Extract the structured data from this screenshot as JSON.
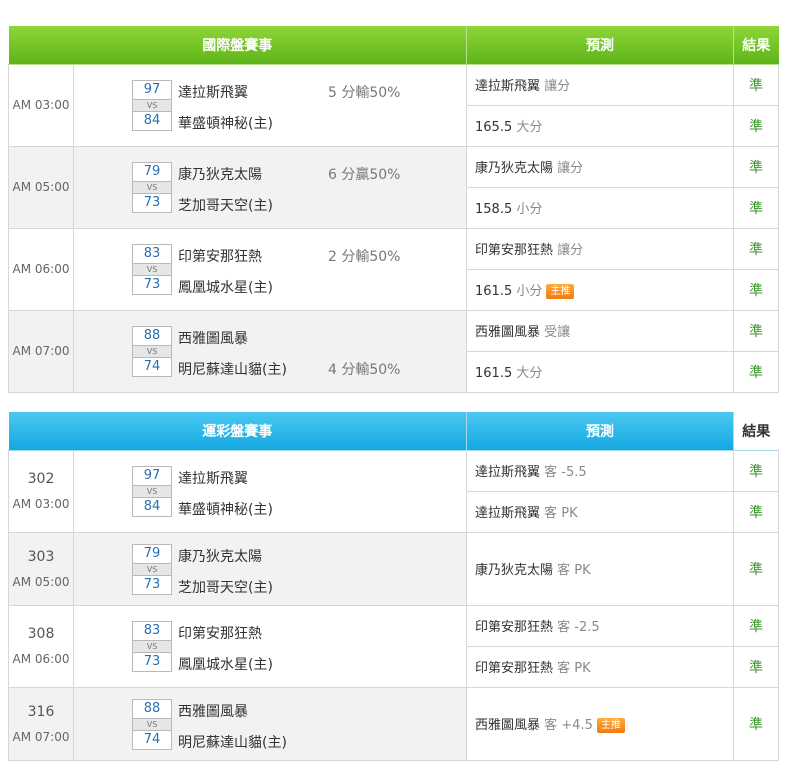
{
  "intl": {
    "header": {
      "match": "國際盤賽事",
      "pred": "預測",
      "res": "結果"
    },
    "games": [
      {
        "time": "AM 03:00",
        "s1": "97",
        "s2": "84",
        "t1": "達拉斯飛翼",
        "t2": "華盛頓神秘(主)",
        "hcp": "5 分輸50%",
        "hcp_row": 1,
        "preds": [
          {
            "main": "達拉斯飛翼",
            "sub": "讓分",
            "res": "準",
            "badge": ""
          },
          {
            "main": "165.5",
            "sub": "大分",
            "res": "準",
            "badge": ""
          }
        ]
      },
      {
        "time": "AM 05:00",
        "s1": "79",
        "s2": "73",
        "t1": "康乃狄克太陽",
        "t2": "芝加哥天空(主)",
        "hcp": "6 分贏50%",
        "hcp_row": 1,
        "preds": [
          {
            "main": "康乃狄克太陽",
            "sub": "讓分",
            "res": "準",
            "badge": ""
          },
          {
            "main": "158.5",
            "sub": "小分",
            "res": "準",
            "badge": ""
          }
        ]
      },
      {
        "time": "AM 06:00",
        "s1": "83",
        "s2": "73",
        "t1": "印第安那狂熱",
        "t2": "鳳凰城水星(主)",
        "hcp": "2 分輸50%",
        "hcp_row": 1,
        "preds": [
          {
            "main": "印第安那狂熱",
            "sub": "讓分",
            "res": "準",
            "badge": ""
          },
          {
            "main": "161.5",
            "sub": "小分",
            "res": "準",
            "badge": "主推"
          }
        ]
      },
      {
        "time": "AM 07:00",
        "s1": "88",
        "s2": "74",
        "t1": "西雅圖風暴",
        "t2": "明尼蘇達山貓(主)",
        "hcp": "4 分輸50%",
        "hcp_row": 2,
        "preds": [
          {
            "main": "西雅圖風暴",
            "sub": "受讓",
            "res": "準",
            "badge": ""
          },
          {
            "main": "161.5",
            "sub": "大分",
            "res": "準",
            "badge": ""
          }
        ]
      }
    ]
  },
  "lottery": {
    "header": {
      "match": "運彩盤賽事",
      "pred": "預測",
      "res": "結果"
    },
    "games": [
      {
        "no": "302",
        "time": "AM 03:00",
        "s1": "97",
        "s2": "84",
        "t1": "達拉斯飛翼",
        "t2": "華盛頓神秘(主)",
        "preds": [
          {
            "main": "達拉斯飛翼",
            "sub": "客 -5.5",
            "res": "準",
            "badge": ""
          },
          {
            "main": "達拉斯飛翼",
            "sub": "客 PK",
            "res": "準",
            "badge": ""
          }
        ]
      },
      {
        "no": "303",
        "time": "AM 05:00",
        "s1": "79",
        "s2": "73",
        "t1": "康乃狄克太陽",
        "t2": "芝加哥天空(主)",
        "preds": [
          {
            "main": "康乃狄克太陽",
            "sub": "客 PK",
            "res": "準",
            "badge": ""
          }
        ]
      },
      {
        "no": "308",
        "time": "AM 06:00",
        "s1": "83",
        "s2": "73",
        "t1": "印第安那狂熱",
        "t2": "鳳凰城水星(主)",
        "preds": [
          {
            "main": "印第安那狂熱",
            "sub": "客 -2.5",
            "res": "準",
            "badge": ""
          },
          {
            "main": "印第安那狂熱",
            "sub": "客 PK",
            "res": "準",
            "badge": ""
          }
        ]
      },
      {
        "no": "316",
        "time": "AM 07:00",
        "s1": "88",
        "s2": "74",
        "t1": "西雅圖風暴",
        "t2": "明尼蘇達山貓(主)",
        "preds": [
          {
            "main": "西雅圖風暴",
            "sub": "客 +4.5",
            "res": "準",
            "badge": "主推"
          }
        ]
      }
    ]
  },
  "vs_label": "VS",
  "colors": {
    "green_header": "#6cc023",
    "blue_header": "#1eb0e6",
    "result_text": "#3a9a2a",
    "score_text": "#2a6fb0",
    "badge": "#f5861c"
  }
}
